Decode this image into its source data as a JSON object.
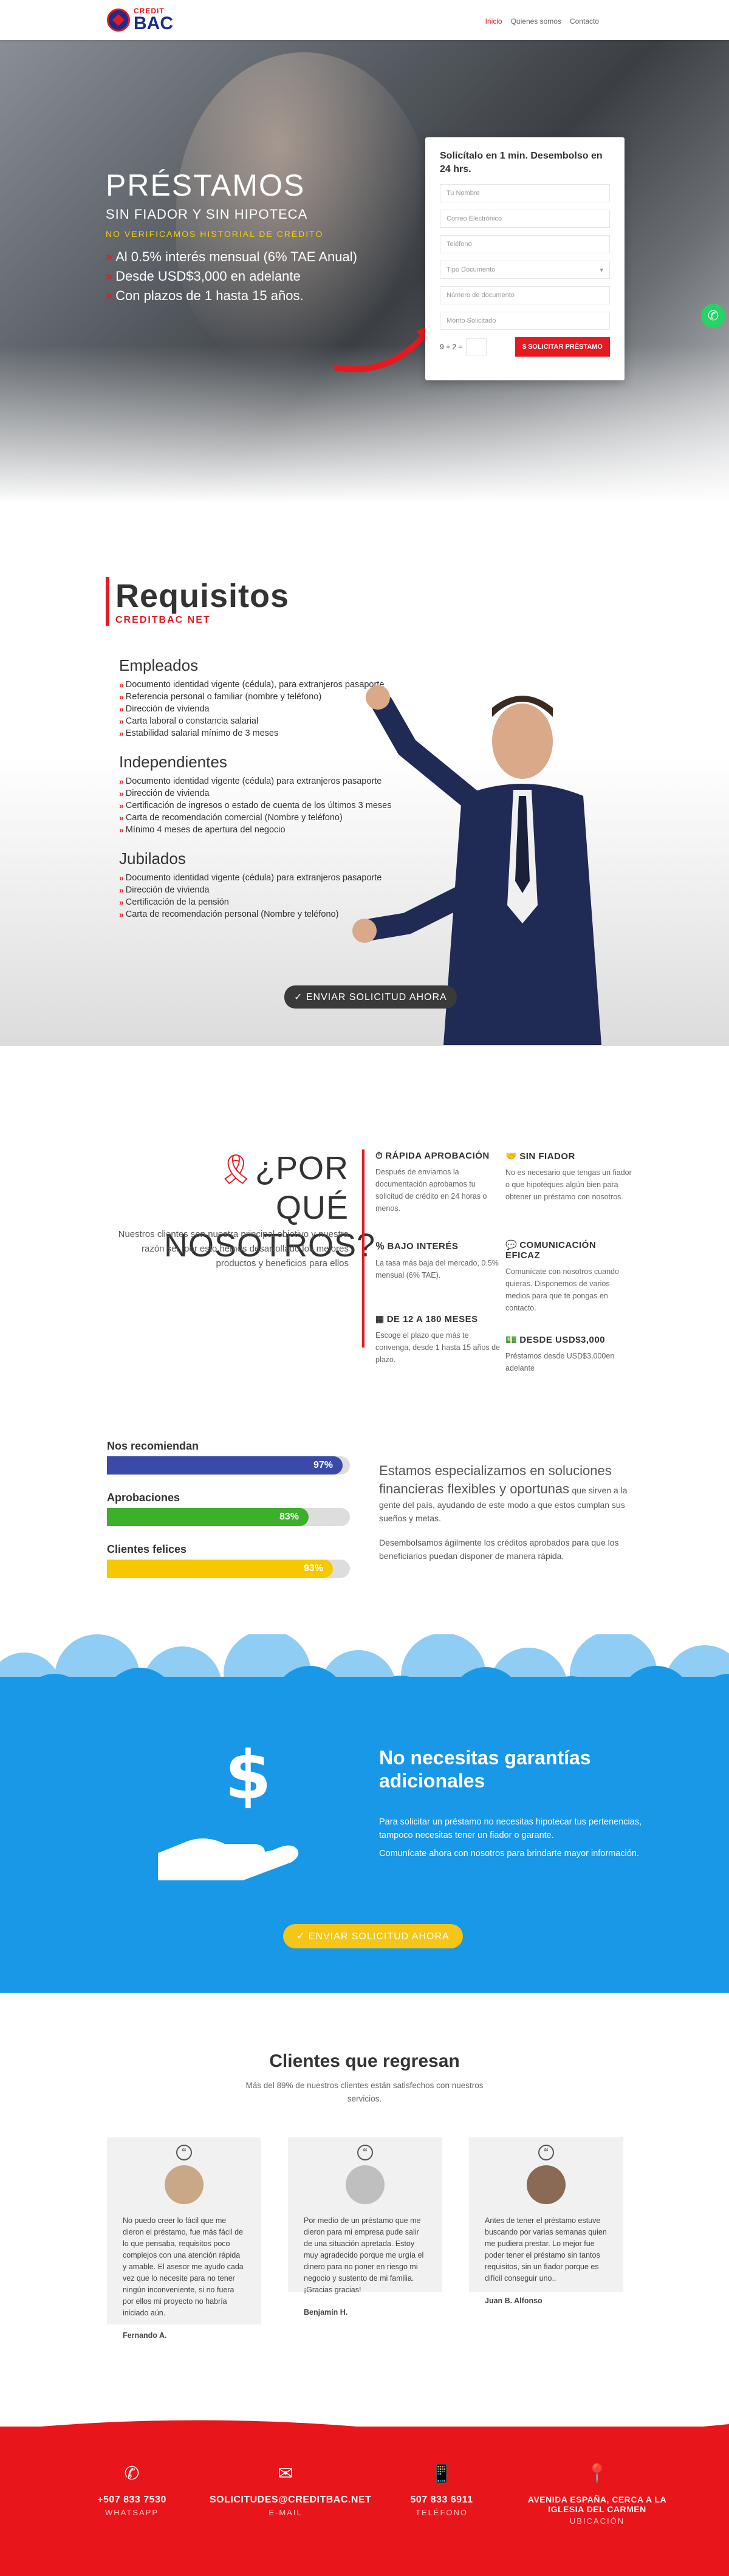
{
  "brand": {
    "small": "CREDIT",
    "big": "BAC"
  },
  "menu": [
    {
      "label": "Inicio"
    },
    {
      "label": "Quienes somos"
    },
    {
      "label": "Contacto"
    }
  ],
  "hero": {
    "title": "PRÉSTAMOS",
    "subtitle": "SIN FIADOR Y SIN HIPOTECA",
    "note": "NO VERIFICAMOS HISTORIAL DE CRÉDITO",
    "bullets": [
      "Al 0.5% interés mensual (6% TAE Anual)",
      "Desde USD$3,000 en adelante",
      "Con plazos de 1 hasta 15 años."
    ]
  },
  "form": {
    "title": "Solicítalo en 1 min. Desembolso en 24 hrs.",
    "fields": [
      "Tu Nombre",
      "Correo Electrónico",
      "Teléfono",
      "Tipo Documento",
      "Número de documento",
      "Monto Solicitado"
    ],
    "captcha": "9 + 2 =",
    "submit": "SOLICITAR PRÉSTAMO"
  },
  "requisitos": {
    "title": "Requisitos",
    "subtitle": "CREDITBAC NET",
    "groups": [
      {
        "title": "Empleados",
        "items": [
          "Documento identidad vigente (cédula), para extranjeros pasaporte",
          "Referencia personal o familiar (nombre y teléfono)",
          "Dirección de vivienda",
          "Carta laboral o constancia salarial",
          "Estabilidad salarial mínimo de 3 meses"
        ]
      },
      {
        "title": "Independientes",
        "items": [
          "Documento identidad vigente (cédula) para extranjeros pasaporte",
          "Dirección de vivienda",
          "Certificación de ingresos o estado de cuenta de los últimos 3 meses",
          "Carta de recomendación comercial (Nombre y teléfono)",
          "Mínimo 4 meses de apertura del negocio"
        ]
      },
      {
        "title": "Jubilados",
        "items": [
          "Documento identidad vigente (cédula) para extranjeros pasaporte",
          "Dirección de vivienda",
          "Certificación de la pensión",
          "Carta de recomendación personal (Nombre y teléfono)"
        ]
      }
    ],
    "button": "✓ ENVIAR SOLICITUD AHORA"
  },
  "why": {
    "title_1": "¿POR QUÉ",
    "title_2": "NOSOTROS?",
    "text": "Nuestros clientes son nuestra principal objetivo y nuestra razón ser, por esto hemos desarrollado los mejores productos y beneficios para ellos",
    "features": [
      {
        "title": "RÁPIDA APROBACIÓN",
        "text": "Después de enviarnos la documentación aprobamos tu solicitud de crédito en 24 horas o menos."
      },
      {
        "title": "SIN FIADOR",
        "text": "No es necesario que tengas un fiador o que hipotéques algún bien para obtener un préstamo con nosotros."
      },
      {
        "title": "BAJO INTERÉS",
        "text": "La tasa más baja del mercado, 0.5% mensual (6% TAE)."
      },
      {
        "title": "COMUNICACIÓN EFICAZ",
        "text": "Comunícate con nosotros cuando quieras. Disponemos de varios medios para que te pongas en contacto."
      },
      {
        "title": "DE 12 A 180 MESES",
        "text": "Escoge el plazo que más te convenga, desde 1 hasta 15 años de plazo."
      },
      {
        "title": "DESDE USD$3,000",
        "text": "Préstamos desde USD$3,000en adelante"
      }
    ]
  },
  "bars": [
    {
      "label": "Nos recomiendan",
      "value": 97,
      "display": "97%",
      "color": "#3b49a8"
    },
    {
      "label": "Aprobaciones",
      "value": 83,
      "display": "83%",
      "color": "#3cb02b"
    },
    {
      "label": "Clientes felices",
      "value": 93,
      "display": "93%",
      "color": "#f5c800"
    }
  ],
  "bars_text": {
    "heading": "Estamos especializamos en soluciones financieras flexibles y oportunas",
    "inline": "que sirven a la gente del país, ayudando de este modo a que estos cumplan sus sueños y metas.",
    "p": "Desembolsamos ágilmente los créditos aprobados para que los beneficiarios puedan disponer de manera rápida."
  },
  "blue": {
    "title": "No necesitas garantías adicionales",
    "p1": "Para solicitar un préstamo no necesitas hipotecar tus pertenencias, tampoco necesitas tener un fiador o garante.",
    "p2": "Comunícate ahora con nosotros para brindarte mayor información.",
    "button": "✓ ENVIAR SOLICITUD AHORA"
  },
  "testimonials": {
    "title": "Clientes que regresan",
    "subtitle": "Más del 89% de nuestros clientes están satisfechos con nuestros servicios.",
    "items": [
      {
        "text": "No puedo creer lo fácil que me dieron el préstamo, fue más fácil de lo que pensaba, requisitos poco complejos con una atención rápida y amable. El asesor me ayudo cada vez que lo necesite para no tener ningún inconveniente, si no fuera por ellos mi proyecto no habría iniciado aún.",
        "name": "Fernando A."
      },
      {
        "text": "Por medio de un préstamo que me dieron para mi empresa pude salir de una situación apretada. Estoy muy agradecido porque me urgía el dinero para no poner en riesgo mi negocio y sustento de mi familia. ¡Gracias gracias!",
        "name": "Benjamín H."
      },
      {
        "text": "Antes de tener el préstamo estuve buscando por varias semanas quien me pudiera prestar. Lo mejor fue poder tener el préstamo sin tantos requisitos, sin un fiador porque es difícil conseguir uno..",
        "name": "Juan B. Alfonso"
      }
    ]
  },
  "footer": [
    {
      "icon": "whatsapp-icon",
      "value": "+507 833 7530",
      "label": "WHATSAPP"
    },
    {
      "icon": "mail-icon",
      "value": "SOLICITUDES@CREDITBAC.NET",
      "label": "E-MAIL"
    },
    {
      "icon": "phone-icon",
      "value": "507 833 6911",
      "label": "TELÉFONO"
    },
    {
      "icon": "location-icon",
      "value": "AVENIDA ESPAÑA, CERCA A LA IGLESIA DEL CARMEN",
      "label": "UBICACIÓN"
    }
  ]
}
